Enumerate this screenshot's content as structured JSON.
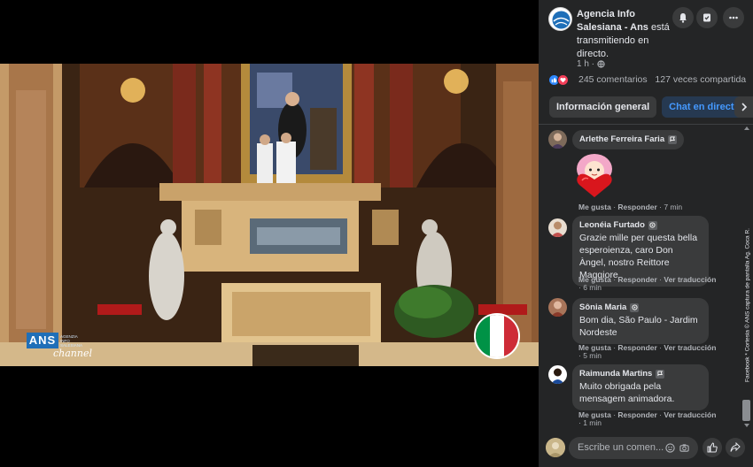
{
  "post": {
    "page_name": "Agencia Info Salesiana - Ans",
    "status_text": " está transmitiendo en directo.",
    "time_ago": "1 h ·",
    "comments_count": "245 comentarios",
    "shares_count": "127 veces compartida"
  },
  "tabs": {
    "general": "Información general",
    "chat": "Chat en directo"
  },
  "video": {
    "logo_text": "ANS",
    "logo_small": "AGENZIA INFO SALESIANA",
    "logo_sub": "channel"
  },
  "comments": [
    {
      "name": "Arlethe Ferreira Faria",
      "text": "",
      "like": "Me gusta",
      "reply": "Responder",
      "time": "7 min",
      "translate": ""
    },
    {
      "name": "Leonéia Furtado",
      "text": "Grazie mille per questa bella esperoienza, caro Don Àngel, nostro Reittore Maggiore",
      "like": "Me gusta",
      "reply": "Responder",
      "translate": "Ver traducción",
      "time": "6 min"
    },
    {
      "name": "Sônia Maria",
      "text": "Bom dia, São Paulo - Jardim Nordeste",
      "like": "Me gusta",
      "reply": "Responder",
      "translate": "Ver traducción",
      "time": "5 min"
    },
    {
      "name": "Raimunda Martins",
      "text": "Muito obrigada pela mensagem animadora.",
      "like": "Me gusta",
      "reply": "Responder",
      "translate": "Ver traducción",
      "time": "1 min"
    }
  ],
  "composer": {
    "placeholder": "Escribe un comen..."
  },
  "credit": "Facebook * Cortesia © ANS captura de pantalla Ag. Coca R.",
  "colors": {
    "panel_bg": "#242526",
    "bubble_bg": "#3a3b3c",
    "accent_blue": "#4599ff",
    "italy_green": "#009246",
    "italy_white": "#ffffff",
    "italy_red": "#ce2b37"
  }
}
